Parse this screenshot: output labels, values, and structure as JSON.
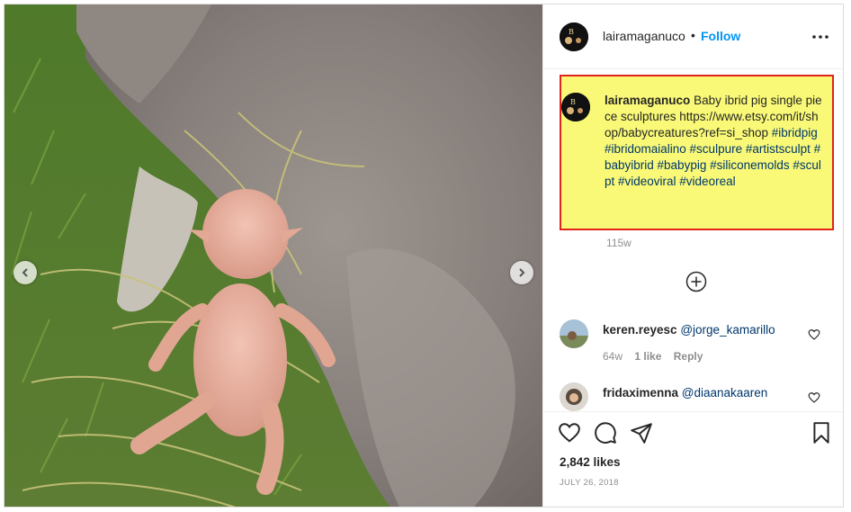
{
  "post": {
    "username": "lairamaganuco",
    "separator": "•",
    "follow_label": "Follow",
    "more_icon": "more-horizontal-icon"
  },
  "caption": {
    "username": "lairamaganuco",
    "text": "Baby ibrid pig single piece sculptures https://www.etsy.com/it/shop/babycreatures?ref=si_shop",
    "hashtags": "#ibridpig #ibridomaialino #sculpure #artistsculpt #babyibrid #babypig #siliconemolds #sculpt #videoviral #videoreal",
    "time_ago": "115w",
    "highlight_color": "#f9f977",
    "highlight_border": "#e0241b"
  },
  "comments": [
    {
      "username": "keren.reyesc",
      "mention": "@jorge_kamarillo",
      "time_ago": "64w",
      "likes": "1 like",
      "reply_label": "Reply"
    },
    {
      "username": "fridaximenna",
      "mention": "@diaanakaaren"
    }
  ],
  "actions": {
    "likes": "2,842 likes",
    "date": "JULY 26, 2018"
  },
  "colors": {
    "link": "#0095f6",
    "tag": "#00376b",
    "muted": "#8e8e8e"
  }
}
